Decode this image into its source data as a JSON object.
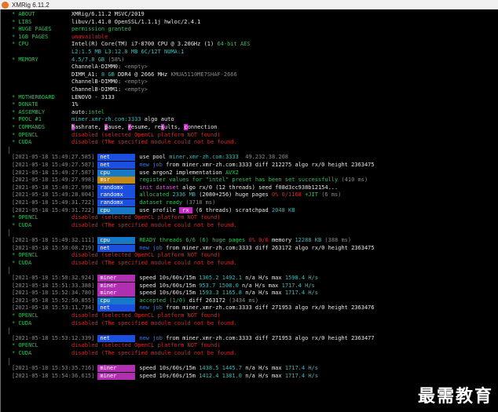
{
  "window": {
    "title": "XMRig 6.11.2",
    "icon": "xmrig-icon"
  },
  "info": {
    "about": [
      "* ABOUT",
      "XMRig/6.11.2 MSVC/2019"
    ],
    "libs": [
      "* LIBS",
      "libuv/1.41.0 OpenSSL/1.1.1j hwloc/2.4.1"
    ],
    "huge": [
      "* HUGE PAGES",
      "permission granted"
    ],
    "gb": [
      "* 1GB PAGES",
      "unavailable"
    ],
    "cpu": [
      "* CPU",
      "Intel(R) Core(TM) i7-8700 CPU @ 3.20GHz (1) ",
      "64-bit AES"
    ],
    "cpu2": [
      "L2:1.5 MB L3:12.0 MB ",
      "6C/12T",
      " NUMA:1"
    ],
    "memory": [
      "* MEMORY",
      "4.5/7.8 GB",
      " (58%)"
    ],
    "ch1": [
      "ChannelA-DIMM0: ",
      "<empty>"
    ],
    "ch2": [
      "DIMM_A1: ",
      "8 GB",
      " DDR4 @ 2666 MHz ",
      "KMUA5110ME7SHAF-2666"
    ],
    "ch3": [
      "ChannelB-DIMM0: ",
      "<empty>"
    ],
    "ch4": [
      "ChannelB-DIMM1: ",
      "<empty>"
    ],
    "mobo": [
      "* MOTHERBOARD",
      "LENOVO - 3133"
    ],
    "donate": [
      "* DONATE",
      "1%"
    ],
    "assembly": [
      "* ASSEMBLY",
      "auto:",
      "intel"
    ],
    "pool": [
      "* POOL #1",
      "miner.xmr-zh.com:3333",
      " algo auto"
    ],
    "commands": [
      "* COMMANDS",
      "h",
      "ashrate, ",
      "p",
      "ause, ",
      "r",
      "esume, re",
      "s",
      "ults, ",
      "c",
      "onnection"
    ],
    "opencl": [
      "* OPENCL",
      "disabled",
      " (selected OpenCL platform NOT found)"
    ],
    "cuda": [
      "* CUDA",
      "disabled",
      " (The specified module could not be found."
    ]
  },
  "log1": [
    {
      "ts": "[2021-05-18 15:49:27.585]",
      "tag": "net",
      "c1": "use pool ",
      "c2": "miner.xmr-zh.com:3333 ",
      "c3": " 49.232.38.208"
    },
    {
      "ts": "[2021-05-18 15:49:27.587]",
      "tag": "net",
      "c1": "new job",
      "c2": " from miner.xmr-zh.com:3333 diff 212275 algo rx/0 height 2363475"
    },
    {
      "ts": "[2021-05-18 15:49:27.587]",
      "tag": "cpu",
      "c1": "use argon2 implementation ",
      "c2": "AVX2"
    },
    {
      "ts": "[2021-05-18 15:49:27.998]",
      "tag": "msr",
      "c1": "register values for \"intel\" preset has been set successfully",
      "c2": " (410 ms)"
    },
    {
      "ts": "[2021-05-18 15:49:27.998]",
      "tag": "randomx",
      "c1": "init dataset",
      "c2": " algo rx/0 (12 threads) seed f08d3cc938b12154..."
    },
    {
      "ts": "[2021-05-18 15:49:28.004]",
      "tag": "randomx",
      "c1": "allocated ",
      "c2": "2336 MB",
      "c3": " (2080+256) huge pages ",
      "c4": "0% 0/1168",
      "c5": " +JIT",
      " c6": " (6 ms)"
    },
    {
      "ts": "[2021-05-18 15:49:31.722]",
      "tag": "randomx",
      "c1": "dataset ready",
      "c2": " (3718 ms)"
    },
    {
      "ts": "[2021-05-18 15:49:31.722]",
      "tag": "cpu",
      "c1": "use profile ",
      "c2": " rx ",
      "c3": " (6 threads) scratchpad ",
      "c4": "2048 KB"
    }
  ],
  "mid1": [
    {
      "ts": "[2021-05-18 15:49:32.111]",
      "tag": "cpu",
      "c1": "READY threads 6/6 (6) huge pages ",
      "c2": "0% 0/6",
      "c3": " memory ",
      "c4": "12288 KB",
      "c5": " (388 ms)"
    },
    {
      "ts": "[2021-05-18 15:50:08.219]",
      "tag": "net",
      "c1": "new job",
      "c2": " from miner.xmr-zh.com:3333 diff 263172 algo rx/0 height 2363475"
    }
  ],
  "miner1": [
    {
      "ts": "[2021-05-18 15:50:32.924]",
      "tag": "miner",
      "c1": "speed 10s/60s/15m ",
      "v1": "1305.2",
      "v2": " 1492.1",
      "v3": " n/a H/s max ",
      "v4": "1598.4 H/s"
    },
    {
      "ts": "[2021-05-18 15:51:33.388]",
      "tag": "miner",
      "c1": "speed 10s/60s/15m ",
      "v1": "953.7",
      "v2": " 1508.0",
      "v3": " n/a H/s max ",
      "v4": "1717.4 H/s"
    },
    {
      "ts": "[2021-05-18 15:52:34.780]",
      "tag": "miner",
      "c1": "speed 10s/60s/15m ",
      "v1": "1593.3",
      "v2": " 1165.8",
      "v3": " n/a H/s max ",
      "v4": "1717.4 H/s"
    },
    {
      "ts": "[2021-05-18 15:52:50.855]",
      "tag": "cpu",
      "c1": "accepted (1/0)",
      "c2": " diff 263172 ",
      "c3": "(3434 ms)"
    },
    {
      "ts": "[2021-05-18 15:53:11.734]",
      "tag": "net",
      "c1": "new job",
      "c2": " from miner.xmr-zh.com:3333 diff 271953 algo rx/0 height 2363476"
    }
  ],
  "net2": {
    "ts": "[2021-05-18 15:53:12.339]",
    "tag": "net",
    "c1": "new job",
    "c2": " from miner.xmr-zh.com:3333 diff 271953 algo rx/0 height 2363477"
  },
  "miner2": [
    {
      "ts": "[2021-05-18 15:53:35.716]",
      "tag": "miner",
      "c1": "speed 10s/60s/15m ",
      "v1": "1438.5",
      "v2": " 1445.7",
      "v3": " n/a H/s max ",
      "v4": "1717.4 H/s"
    },
    {
      "ts": "[2021-05-18 15:54:36.615]",
      "tag": "miner",
      "c1": "speed 10s/60s/15m ",
      "v1": "1412.4",
      "v2": " 1381.0",
      "v3": " n/a H/s max ",
      "v4": "1717.4 H/s"
    }
  ],
  "watermark": "最需教育",
  "colors": {
    "green": "#2ec05a",
    "cyan": "#3fb8b8",
    "red": "#d12a2a",
    "blue": "#3d7bd9",
    "magenta": "#c12fc1",
    "netTag": "#1a4fe0",
    "cpuTag": "#1579c8",
    "msrTag": "#c28a16"
  }
}
